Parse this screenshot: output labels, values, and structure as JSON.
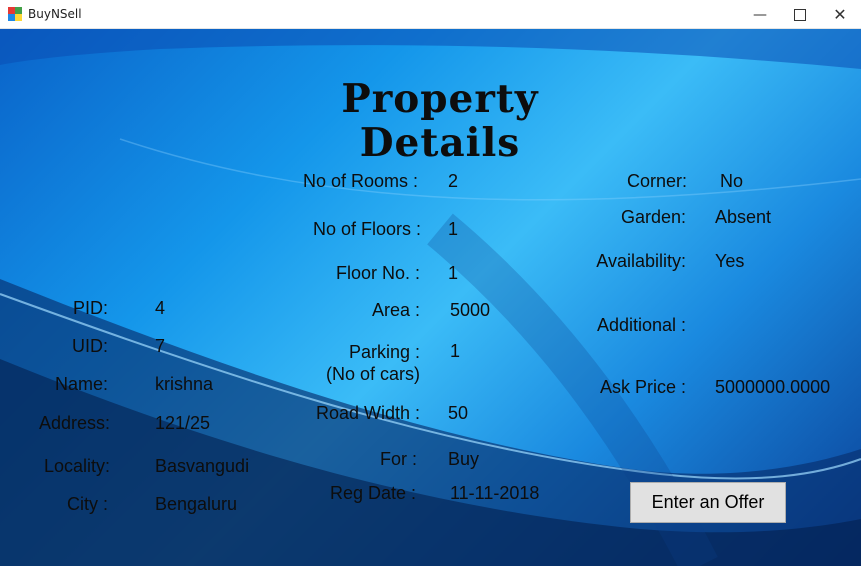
{
  "window": {
    "title": "BuyNSell",
    "minimize": "—",
    "close": "✕"
  },
  "heading": {
    "line1": "Property",
    "line2": "Details"
  },
  "owner": {
    "pid_label": "PID:",
    "pid": "4",
    "uid_label": "UID:",
    "uid": "7",
    "name_label": "Name:",
    "name": "krishna",
    "address_label": "Address:",
    "address": "121/25",
    "locality_label": "Locality:",
    "locality": "Basvangudi",
    "city_label": "City :",
    "city": "Bengaluru"
  },
  "property": {
    "rooms_label": "No of Rooms :",
    "rooms": "2",
    "floors_label": "No of Floors :",
    "floors": "1",
    "floor_no_label": "Floor No. :",
    "floor_no": "1",
    "area_label": "Area :",
    "area": "5000",
    "parking_label": "Parking :\n(No of cars)",
    "parking": "1",
    "road_width_label": "Road Width :",
    "road_width": "50",
    "for_label": "For :",
    "for": "Buy",
    "reg_date_label": "Reg Date :",
    "reg_date": "11-11-2018"
  },
  "extra": {
    "corner_label": "Corner:",
    "corner": "No",
    "garden_label": "Garden:",
    "garden": "Absent",
    "availability_label": "Availability:",
    "availability": "Yes",
    "additional_label": "Additional :",
    "additional": "",
    "ask_price_label": "Ask Price :",
    "ask_price": "5000000.0000"
  },
  "offer_button": "Enter an Offer"
}
